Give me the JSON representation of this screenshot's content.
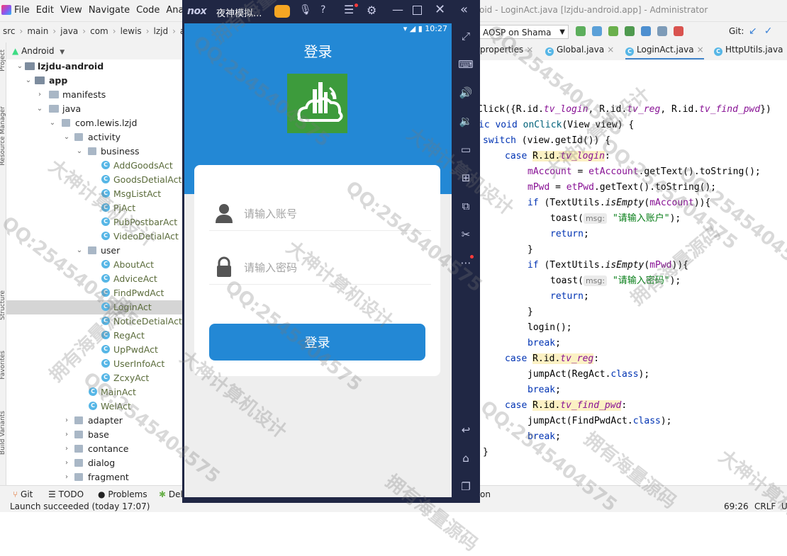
{
  "ide": {
    "menu": [
      "File",
      "Edit",
      "View",
      "Navigate",
      "Code",
      "Ana"
    ],
    "window_title": "oid - LoginAct.java [lzjdu-android.app] - Administrator",
    "breadcrumb": [
      "src",
      "main",
      "java",
      "com",
      "lewis",
      "lzjd",
      "act"
    ],
    "device_selector": "AOSP on Shama",
    "git_label": "Git:",
    "project_view": "Android",
    "side_labels": [
      "Project",
      "Resource Manager",
      "Structure",
      "Favorites",
      "Build Variants"
    ],
    "tree": [
      {
        "label": "lzjdu-android",
        "kind": "module"
      },
      {
        "label": "app",
        "kind": "module"
      },
      {
        "label": "manifests",
        "kind": "folder"
      },
      {
        "label": "java",
        "kind": "folder"
      },
      {
        "label": "com.lewis.lzjd",
        "kind": "package"
      },
      {
        "label": "activity",
        "kind": "package"
      },
      {
        "label": "business",
        "kind": "package"
      },
      {
        "label": "AddGoodsAct",
        "kind": "class"
      },
      {
        "label": "GoodsDetialAct",
        "kind": "class"
      },
      {
        "label": "MsgListAct",
        "kind": "class"
      },
      {
        "label": "PjAct",
        "kind": "class"
      },
      {
        "label": "PubPostbarAct",
        "kind": "class"
      },
      {
        "label": "VideoDetialAct",
        "kind": "class"
      },
      {
        "label": "user",
        "kind": "package"
      },
      {
        "label": "AboutAct",
        "kind": "class"
      },
      {
        "label": "AdviceAct",
        "kind": "class"
      },
      {
        "label": "FindPwdAct",
        "kind": "class"
      },
      {
        "label": "LoginAct",
        "kind": "class"
      },
      {
        "label": "NoticeDetialAct",
        "kind": "class"
      },
      {
        "label": "RegAct",
        "kind": "class"
      },
      {
        "label": "UpPwdAct",
        "kind": "class"
      },
      {
        "label": "UserInfoAct",
        "kind": "class"
      },
      {
        "label": "ZcxyAct",
        "kind": "class"
      },
      {
        "label": "MainAct",
        "kind": "class"
      },
      {
        "label": "WelAct",
        "kind": "class"
      },
      {
        "label": "adapter",
        "kind": "package"
      },
      {
        "label": "base",
        "kind": "package"
      },
      {
        "label": "contance",
        "kind": "package"
      },
      {
        "label": "dialog",
        "kind": "package"
      },
      {
        "label": "fragment",
        "kind": "package"
      }
    ],
    "tabs": [
      "properties",
      "Global.java",
      "LoginAct.java",
      "HttpUtils.java"
    ],
    "code": {
      "l1": [
        "Click({R.id.",
        "tv_login",
        ", R.id.",
        "tv_reg",
        ", R.id.",
        "tv_find_pwd",
        "})"
      ],
      "l2": [
        "ic void ",
        "onClick",
        "(View view) {"
      ],
      "l3": [
        "switch",
        " (view.getId()) {"
      ],
      "l4": [
        "case ",
        "R.id.",
        "tv_login",
        ":"
      ],
      "l5": [
        "mAccount",
        " = ",
        "etAccount",
        ".getText().toString();"
      ],
      "l6": [
        "mPwd",
        " = ",
        "etPwd",
        ".getText().toString();"
      ],
      "l7": [
        "if",
        " (TextUtils.",
        "isEmpty",
        "(",
        "mAccount",
        ")){"
      ],
      "l8": [
        "toast(",
        "msg:",
        "\"请输入账户\"",
        ");"
      ],
      "l9": [
        "return",
        ";"
      ],
      "l10": [
        "}"
      ],
      "l11": [
        "if",
        " (TextUtils.",
        "isEmpty",
        "(",
        "mPwd",
        ")){"
      ],
      "l12": [
        "toast(",
        "msg:",
        "\"请输入密码\"",
        ");"
      ],
      "l13": [
        "return",
        ";"
      ],
      "l14": [
        "}"
      ],
      "l15": [
        "login();"
      ],
      "l16": [
        "break",
        ";"
      ],
      "l17": [
        "case ",
        "R.id.",
        "tv_reg",
        ":"
      ],
      "l18": [
        "jumpAct(RegAct.",
        "class",
        ");"
      ],
      "l19": [
        "break",
        ";"
      ],
      "l20": [
        "case ",
        "R.id.",
        "tv_find_pwd",
        ":"
      ],
      "l21": [
        "jumpAct(FindPwdAct.",
        "class",
        ");"
      ],
      "l22": [
        "break",
        ";"
      ],
      "l23": [
        "}"
      ]
    },
    "bottom_tools": [
      "Git",
      "TODO",
      "Problems",
      "Del",
      "on"
    ],
    "status": {
      "message": "Launch succeeded (today 17:07)",
      "position": "69:26",
      "line_ending": "CRLF",
      "encoding": "U"
    }
  },
  "emulator": {
    "logo": "nox",
    "title": "夜神模拟...",
    "status_time": "10:27",
    "app": {
      "title": "登录",
      "account_placeholder": "请输入账号",
      "password_placeholder": "请输入密码",
      "login_button": "登录"
    }
  },
  "watermarks": [
    "QQ:2545404575",
    "拥有海量源码",
    "大神计算机设计"
  ],
  "colors": {
    "app_blue": "#2388d5",
    "emulator_frame": "#202744",
    "logo_green": "#3d9b3c"
  }
}
